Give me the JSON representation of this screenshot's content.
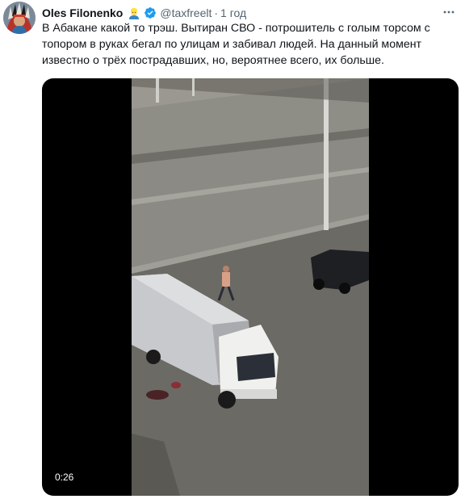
{
  "tweet": {
    "author": {
      "display_name": "Oles Filonenko",
      "emoji_badge": "man-with-blond-hair-emoji",
      "verified_icon": "verified-badge-icon",
      "handle": "@taxfreelt",
      "separator": "·",
      "time": "1 год"
    },
    "text": "В Абакане какой то трэш. Вытиран СВО - потрошитель с голым торсом с топором в руках бегал по улицам и забивал людей. На данный момент известно о трёх пострадавших, но, вероятнее всего, их больше.",
    "media": {
      "type": "video",
      "duration": "0:26"
    },
    "more_icon": "more-horizontal-icon"
  },
  "colors": {
    "text_primary": "#0f1419",
    "text_secondary": "#536471",
    "verified": "#1d9bf0"
  }
}
